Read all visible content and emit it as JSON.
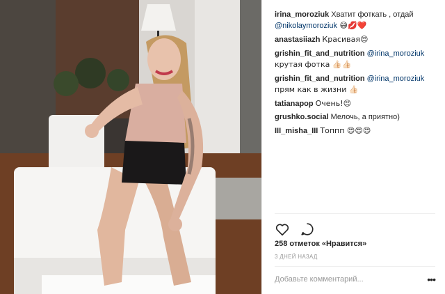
{
  "comments": [
    {
      "user": "irina_moroziuk",
      "text": "Хватит фоткать , отдай ",
      "mention": "@nikolaymoroziuk",
      "tail": " 😅💋❤️"
    },
    {
      "user": "anastasiiazh",
      "text": "Красивая😍",
      "mention": "",
      "tail": ""
    },
    {
      "user": "grishin_fit_and_nutrition",
      "text": "",
      "mention": "@irina_moroziuk",
      "tail": " крутая фотка 👍🏻👍🏻"
    },
    {
      "user": "grishin_fit_and_nutrition",
      "text": "",
      "mention": "@irina_moroziuk",
      "tail": " прям как в жизни 👍🏻"
    },
    {
      "user": "tatianapop",
      "text": "Очень!😍",
      "mention": "",
      "tail": ""
    },
    {
      "user": "grushko.social",
      "text": "Мелочь, а приятно)",
      "mention": "",
      "tail": ""
    },
    {
      "user": "III_misha_III",
      "text": "Топпп 😍😍😍",
      "mention": "",
      "tail": ""
    }
  ],
  "actions": {
    "like_icon": "heart-icon",
    "comment_icon": "comment-icon"
  },
  "likes": "258 отметок «Нравится»",
  "time": "3 ДНЕЙ НАЗАД",
  "add_comment": {
    "placeholder": "Добавьте комментарий...",
    "more_icon": "more-icon"
  }
}
